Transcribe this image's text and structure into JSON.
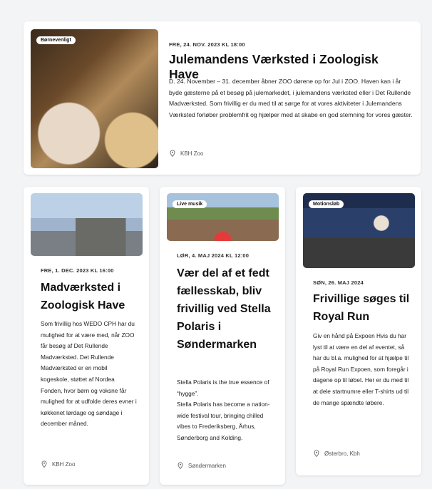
{
  "events": [
    {
      "badge": "Børnevenligt",
      "date": "FRE, 24. NOV. 2023 KL 18:00",
      "title": "Julemandens Værksted i Zoologisk Have",
      "description": "D. 24. November – 31. december åbner ZOO dørene op for Jul i ZOO. Haven kan i år byde gæsterne på et besøg på julemarkedet, i julemandens værksted eller i Det Rullende Madværksted. Som frivillig er du med til at sørge for at vores aktiviteter i Julemandens Værksted forløber problemfrit og hjælper med at skabe en god stemning for vores gæster.",
      "location": "KBH Zoo"
    },
    {
      "badge": "",
      "date": "FRE, 1. DEC. 2023 KL 16:00",
      "title": "Madværksted i Zoologisk Have",
      "description": "Som frivillig hos WEDO CPH har du mulighed for at være med, når ZOO får besøg af Det Rullende Madværksted. Det Rullende Madværksted er en mobil kogeskole, støttet af Nordea Fonden, hvor børn og voksne får mulighed for at udfolde deres evner i køkkenet lørdage og søndage i december måned.",
      "location": "KBH Zoo"
    },
    {
      "badge": "Live musik",
      "date": "LØR, 4. MAJ 2024 KL 12:00",
      "title": "Vær del af et fedt fællesskab, bliv frivillig ved Stella Polaris i Søndermarken",
      "description_lines": [
        "Stella Polaris is the true essence of “hygge”.",
        "Stella Polaris has become a nation-wide festival tour, bringing chilled vibes to Frederiksberg, Århus, Sønderborg and Kolding."
      ],
      "location": "Søndermarken"
    },
    {
      "badge": "Motionsløb",
      "date": "SØN, 26. MAJ 2024",
      "title": "Frivillige søges til Royal Run",
      "description": "Giv en hånd på Expoen Hvis du har lyst til at være en del af eventet, så har du bl.a. mulighed for at hjælpe til på Royal Run Expoen, som foregår i dagene op til løbet. Her er du med til at dele startnumre eller T-shirts ud til de mange spændte løbere.",
      "location": "Østerbro, Kbh"
    }
  ],
  "icons": {
    "location": "map-pin-icon"
  },
  "colors": {
    "background": "#f3f4f6",
    "card": "#ffffff",
    "text": "#111111"
  }
}
